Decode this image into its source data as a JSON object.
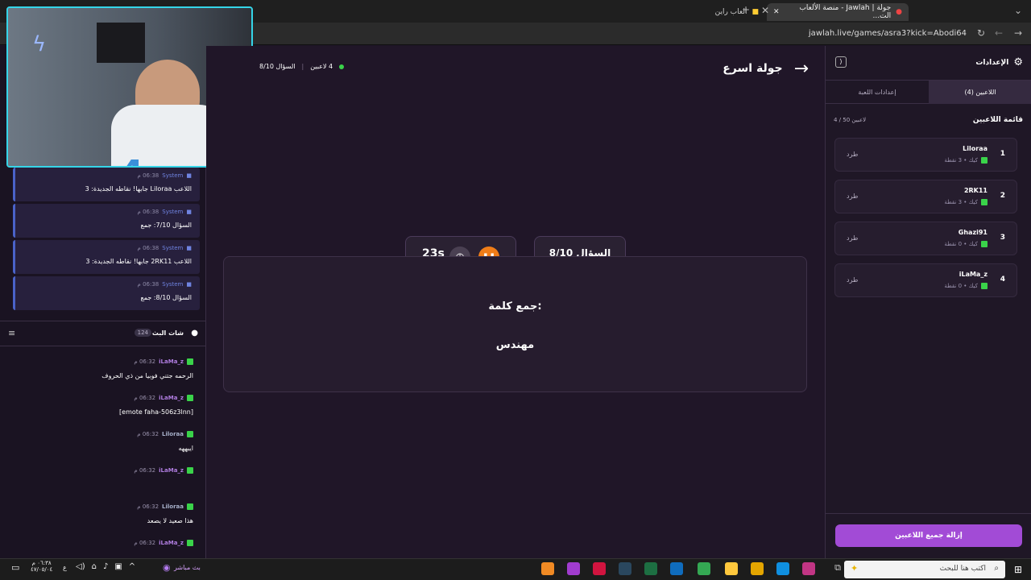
{
  "browser": {
    "tabs": [
      {
        "label": "جولة | Jawlah - منصة الألعاب الت..."
      },
      {
        "label": "العاب راين"
      }
    ],
    "url": "jawlah.live/games/asra3?kick=Abodi64"
  },
  "game": {
    "title": "جولة اسرع",
    "players_online": "4 لاعبين",
    "question_counter_top": "السؤال 8/10",
    "question_counter": "السؤال 8/10",
    "timer": "23s",
    "prompt": "جمع كلمة:",
    "word": "مهندس"
  },
  "sidebar": {
    "title": "الإعدادات",
    "tabs": [
      {
        "label": "اللاعبين (4)"
      },
      {
        "label": "إعدادات اللعبة"
      }
    ],
    "list_title": "قائمة اللاعبين",
    "list_count": "4 / 50 لاعبين",
    "kick_label": "طرد",
    "players": [
      {
        "rank": "1",
        "name": "Liloraa",
        "meta": "كيك • 3 نقطة"
      },
      {
        "rank": "2",
        "name": "2RK11",
        "meta": "كيك • 3 نقطة"
      },
      {
        "rank": "3",
        "name": "Ghazi91",
        "meta": "كيك • 0 نقطة"
      },
      {
        "rank": "4",
        "name": "iLaMa_z",
        "meta": "كيك • 0 نقطة"
      }
    ],
    "remove_all": "إزالة جميع اللاعبين"
  },
  "system_log": [
    {
      "sender": "System",
      "time": "06:38 م",
      "text": "اللاعب Liloraa جابها! نقاطه الجديدة: 3"
    },
    {
      "sender": "System",
      "time": "06:38 م",
      "text": "السؤال 7/10: جمع"
    },
    {
      "sender": "System",
      "time": "06:38 م",
      "text": "اللاعب 2RK11 جابها! نقاطه الجديدة: 3"
    },
    {
      "sender": "System",
      "time": "06:38 م",
      "text": "السؤال 8/10: جمع"
    }
  ],
  "chat": {
    "title": "شات البث",
    "count": "124",
    "messages": [
      {
        "user": "iLaMa_z",
        "time": "06:32 م",
        "text": "الرحمه جتني فوبيا من ذي الحروف"
      },
      {
        "user": "iLaMa_z",
        "time": "06:32 م",
        "text": "[emote faha-506z3lnn]"
      },
      {
        "user": "Liloraa",
        "time": "06:32 م",
        "text": "ايبههه"
      },
      {
        "user": "iLaMa_z",
        "time": "06:32 م",
        "text": ""
      },
      {
        "user": "Liloraa",
        "time": "06:32 م",
        "text": "هذا صعيد لا يصعد"
      },
      {
        "user": "iLaMa_z",
        "time": "06:32 م",
        "text": ""
      }
    ]
  },
  "taskbar": {
    "search_placeholder": "اكتب هنا للبحث",
    "live_label": "بث مباشر",
    "clock_time": "٠٦:٣٨ م",
    "clock_date": "٤٧/٠٥/٠٤",
    "lang": "ع"
  },
  "colors": {
    "accent_purple": "#a24bd6",
    "pause_orange": "#f07d18",
    "kick_green": "#3ad34a",
    "system_blue": "#4a63c9"
  }
}
